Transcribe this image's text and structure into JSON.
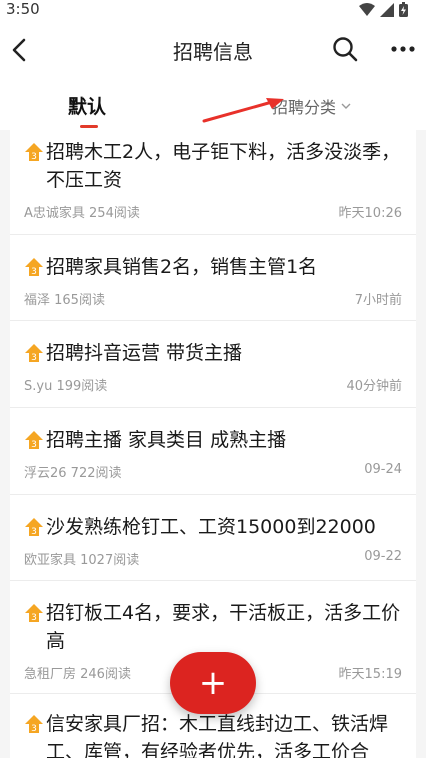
{
  "status": {
    "time": "3:50"
  },
  "nav": {
    "title": "招聘信息"
  },
  "tabs": {
    "default": "默认",
    "category": "招聘分类"
  },
  "colors": {
    "accent": "#dc2420",
    "pin": "#f5a623"
  },
  "fab": {
    "label": "+"
  },
  "items": [
    {
      "title": "招聘木工2人，电子钜下料，活多没淡季，不压工资",
      "meta": "A忠诚家具 254阅读",
      "time": "昨天10:26"
    },
    {
      "title": "招聘家具销售2名，销售主管1名",
      "meta": "福泽 165阅读",
      "time": "7小时前"
    },
    {
      "title": "招聘抖音运营 带货主播",
      "meta": "S.yu 199阅读",
      "time": "40分钟前"
    },
    {
      "title": "招聘主播 家具类目 成熟主播",
      "meta": "浮云26 722阅读",
      "time": "09-24"
    },
    {
      "title": "沙发熟练枪钉工、工资15000到22000",
      "meta": "欧亚家具 1027阅读",
      "time": "09-22"
    },
    {
      "title": "招钉板工4名，要求，干活板正，活多工价高",
      "meta": "急租厂房 246阅读",
      "time": "昨天15:19"
    },
    {
      "title": "信安家具厂招：木工直线封边工、铁活焊工、库管，有经验者优先，活多工价合",
      "meta": "",
      "time": ""
    }
  ]
}
